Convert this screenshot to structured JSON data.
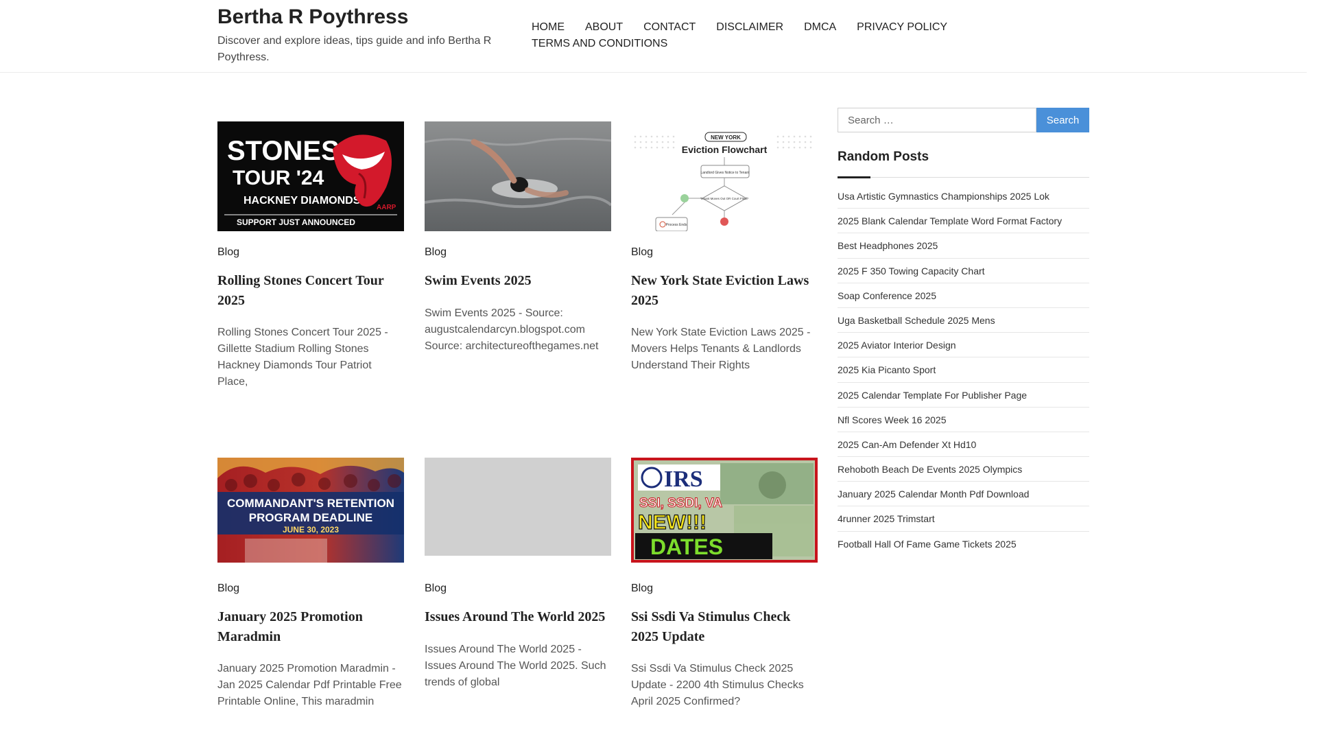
{
  "site": {
    "title": "Bertha R Poythress",
    "tagline": "Discover and explore ideas, tips guide and info Bertha R Poythress."
  },
  "nav": [
    "HOME",
    "ABOUT",
    "CONTACT",
    "DISCLAIMER",
    "DMCA",
    "PRIVACY POLICY",
    "TERMS AND CONDITIONS"
  ],
  "posts": [
    {
      "category": "Blog",
      "title": "Rolling Stones Concert Tour 2025",
      "excerpt": "Rolling Stones Concert Tour 2025 - Gillette Stadium Rolling Stones Hackney Diamonds Tour Patriot Place,",
      "thumb": {
        "line1": "STONES",
        "line2": "TOUR '24",
        "line3": "HACKNEY DIAMONDS",
        "line4": "SUPPORT JUST ANNOUNCED",
        "badge": "AARP"
      }
    },
    {
      "category": "Blog",
      "title": "Swim Events 2025",
      "excerpt": "Swim Events 2025 - Source: augustcalendarcyn.blogspot.com Source: architectureofthegames.net"
    },
    {
      "category": "Blog",
      "title": "New York State Eviction Laws 2025",
      "excerpt": "New York State Eviction Laws 2025 - Movers Helps Tenants & Landlords Understand Their Rights",
      "thumb": {
        "tag": "NEW YORK",
        "heading": "Eviction Flowchart",
        "box1": "Landlord Gives Notice to Tenant",
        "box2": "Tenant Moves Out OR Court Filed?",
        "box3": "Process Ends"
      }
    },
    {
      "category": "Blog",
      "title": "January 2025 Promotion Maradmin",
      "excerpt": "January 2025 Promotion Maradmin - Jan 2025 Calendar Pdf Printable Free Printable Online, This maradmin",
      "thumb": {
        "line1": "COMMANDANT'S RETENTION",
        "line2": "PROGRAM DEADLINE",
        "line3": "JUNE 30, 2023"
      }
    },
    {
      "category": "Blog",
      "title": "Issues Around The World 2025",
      "excerpt": "Issues Around The World 2025 - Issues Around The World 2025. Such trends of global"
    },
    {
      "category": "Blog",
      "title": "Ssi Ssdi Va Stimulus Check 2025 Update",
      "excerpt": "Ssi Ssdi Va Stimulus Check 2025 Update - 2200 4th Stimulus Checks April 2025 Confirmed?",
      "thumb": {
        "logo": "IRS",
        "line1": "SSI, SSDI, VA",
        "line2": "NEW!!!",
        "line3": "DATES"
      }
    }
  ],
  "sidebar": {
    "search_placeholder": "Search …",
    "search_button": "Search",
    "random_title": "Random Posts",
    "random_posts": [
      "Usa Artistic Gymnastics Championships 2025 Lok",
      "2025 Blank Calendar Template Word Format Factory",
      "Best Headphones 2025",
      "2025 F 350 Towing Capacity Chart",
      "Soap Conference 2025",
      "Uga Basketball Schedule 2025 Mens",
      "2025 Aviator Interior Design",
      "2025 Kia Picanto Sport",
      "2025 Calendar Template For Publisher Page",
      "Nfl Scores Week 16 2025",
      "2025 Can-Am Defender Xt Hd10",
      "Rehoboth Beach De Events 2025 Olympics",
      "January 2025 Calendar Month Pdf Download",
      "4runner 2025 Trimstart",
      "Football Hall Of Fame Game Tickets 2025"
    ]
  }
}
